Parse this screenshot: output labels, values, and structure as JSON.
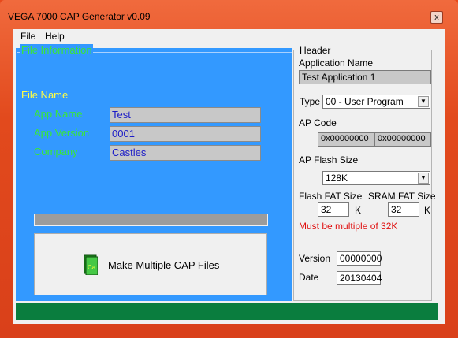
{
  "window": {
    "title": "VEGA 7000 CAP Generator v0.09",
    "close_glyph": "x"
  },
  "menu": [
    "File",
    "Help"
  ],
  "left_panel": {
    "group_title": "File Information",
    "file_name_label": "File Name",
    "fields": [
      {
        "label": "App Name",
        "value": "Test"
      },
      {
        "label": "App Version",
        "value": "0001"
      },
      {
        "label": "Company",
        "value": "Castles"
      }
    ],
    "make_button_label": "Make Multiple CAP Files",
    "make_button_icon": "Ca"
  },
  "header": {
    "group_title": "Header",
    "app_name_label": "Application Name",
    "app_name_value": "Test Application 1",
    "type_label": "Type",
    "type_value": "00 - User Program",
    "ap_code_label": "AP Code",
    "ap_code_values": [
      "0x00000000",
      "0x00000000"
    ],
    "ap_flash_size_label": "AP Flash Size",
    "ap_flash_size_value": "128K",
    "flash_fat_label": "Flash FAT Size",
    "flash_fat_value": "32",
    "sram_fat_label": "SRAM FAT Size",
    "sram_fat_value": "32",
    "unit": "K",
    "warning": "Must be multiple of 32K",
    "version_label": "Version",
    "version_value": "00000000",
    "date_label": "Date",
    "date_value": "20130404"
  },
  "colors": {
    "panel_blue": "#3399ff",
    "label_green": "#39e639",
    "label_yellow": "#ffff44",
    "status_green": "#0a7d3e",
    "warning_red": "#e01010"
  }
}
